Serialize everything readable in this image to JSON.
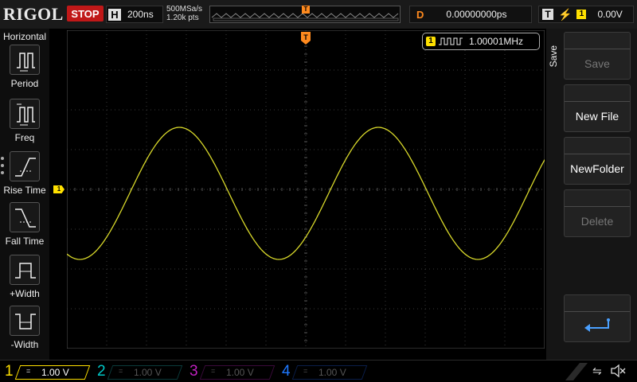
{
  "topbar": {
    "brand": "RIGOL",
    "run_state": "STOP",
    "timebase_letter": "H",
    "timebase": "200ns",
    "sample_rate": "500MSa/s",
    "mem_depth": "1.20k pts",
    "trigger_pos_letter": "T",
    "delay_letter": "D",
    "delay_value": "0.00000000ps",
    "trig_letter": "T",
    "trig_edge_icon": "rising-edge-icon",
    "trig_source": "1",
    "trig_level": "0.00V"
  },
  "left_panel": {
    "title": "Horizontal",
    "items": [
      {
        "label": "Period",
        "icon": "period-icon"
      },
      {
        "label": "Freq",
        "icon": "freq-icon"
      },
      {
        "label": "Rise Time",
        "icon": "rise-time-icon"
      },
      {
        "label": "Fall Time",
        "icon": "fall-time-icon"
      },
      {
        "label": "+Width",
        "icon": "positive-width-icon"
      },
      {
        "label": "-Width",
        "icon": "negative-width-icon"
      }
    ]
  },
  "display": {
    "ch1_marker": "1",
    "trig_level_marker": "T",
    "measurement": {
      "channel": "1",
      "value": "1.00001MHz"
    },
    "trace_color": "#d8d82a"
  },
  "right_menu": {
    "tab": "Save",
    "buttons": [
      {
        "label": "Save",
        "enabled": false
      },
      {
        "label": "New File",
        "enabled": true
      },
      {
        "label": "NewFolder",
        "enabled": true
      },
      {
        "label": "Delete",
        "enabled": false
      },
      {
        "label": "",
        "icon": "back-arrow-icon",
        "enabled": true
      }
    ]
  },
  "bottombar": {
    "channels": [
      {
        "num": "1",
        "coupling": "=",
        "scale": "1.00 V",
        "color": "#ffe000"
      },
      {
        "num": "2",
        "coupling": "=",
        "scale": "1.00 V",
        "color": "#00c8c8"
      },
      {
        "num": "3",
        "coupling": "=",
        "scale": "1.00 V",
        "color": "#c020c0"
      },
      {
        "num": "4",
        "coupling": "=",
        "scale": "1.00 V",
        "color": "#1e78ff"
      }
    ],
    "usb_icon": "usb-icon",
    "speaker_icon": "speaker-muted-icon"
  }
}
